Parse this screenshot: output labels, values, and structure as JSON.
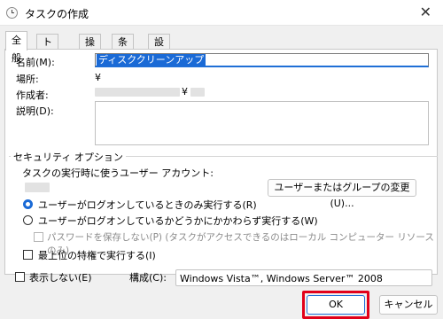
{
  "window": {
    "title": "タスクの作成",
    "close_glyph": "✕"
  },
  "tabs": [
    {
      "label": "全般",
      "active": true
    },
    {
      "label": "トリガー"
    },
    {
      "label": "操作"
    },
    {
      "label": "条件"
    },
    {
      "label": "設定"
    }
  ],
  "general": {
    "name_label": "名前(M):",
    "name_value": "ディスククリーンアップ",
    "location_label": "場所:",
    "location_value": "¥",
    "author_label": "作成者:",
    "author_value": "¥",
    "description_label": "説明(D):"
  },
  "security": {
    "group_title": "セキュリティ オプション",
    "account_label": "タスクの実行時に使うユーザー アカウント:",
    "change_button": "ユーザーまたはグループの変更(U)...",
    "radio_logged_on": "ユーザーがログオンしているときのみ実行する(R)",
    "radio_whether": "ユーザーがログオンしているかどうかにかかわらず実行する(W)",
    "no_store_password": "パスワードを保存しない(P) (タスクがアクセスできるのはローカル コンピューター リソースのみ)",
    "highest_priv": "最上位の特権で実行する(I)"
  },
  "footer": {
    "hidden_label": "表示しない(E)",
    "configure_label": "構成(C):",
    "configure_value": "Windows Vista™, Windows Server™ 2008",
    "ok": "OK",
    "cancel": "キャンセル"
  },
  "colors": {
    "accent": "#1a6ad6",
    "highlight": "#e2001a"
  }
}
